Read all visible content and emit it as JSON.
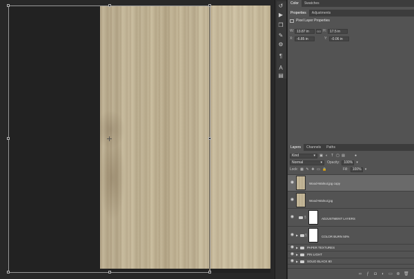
{
  "canvas": {
    "layer_top_name": "Wood-Walnut.jpg copy",
    "layer_name": "Wood-Walnut.jpg"
  },
  "toolbar": {
    "tools": [
      {
        "name": "history-icon",
        "glyph": "↺"
      },
      {
        "name": "play-icon",
        "glyph": "▶"
      },
      {
        "name": "clone-source-icon",
        "glyph": "❐"
      },
      {
        "name": "brush-settings-icon",
        "glyph": "✎"
      },
      {
        "name": "adjust-icon",
        "glyph": "⚙"
      },
      {
        "name": "paragraph-icon",
        "glyph": "¶"
      },
      {
        "name": "character-icon",
        "glyph": "A"
      },
      {
        "name": "notes-icon",
        "glyph": "▤"
      }
    ]
  },
  "top_panel": {
    "tabs": [
      "Color",
      "Swatches"
    ]
  },
  "properties_panel": {
    "tabs": [
      "Properties",
      "Adjustments"
    ],
    "section_title": "Pixel Layer Properties",
    "w_label": "W:",
    "w_value": "13.87 in",
    "h_label": "H:",
    "h_value": "17.5 in",
    "x_label": "X:",
    "x_value": "-6.85 in",
    "y_label": "Y:",
    "y_value": "-0.06 in",
    "link_label": "GO"
  },
  "layers_panel": {
    "tabs": [
      "Layers",
      "Channels",
      "Paths"
    ],
    "filter_label": "Kind",
    "blend_mode": "Normal",
    "opacity_label": "Opacity:",
    "opacity_value": "100%",
    "lock_label": "Lock:",
    "fill_label": "Fill:",
    "fill_value": "100%",
    "layers": [
      {
        "name": "Wood-Walnut.jpg copy",
        "type": "pixel",
        "selected": true
      },
      {
        "name": "Wood-Walnut.jpg",
        "type": "pixel",
        "selected": false
      },
      {
        "name": "ADJUSTMENT LAYERS",
        "type": "group-mask",
        "selected": false
      },
      {
        "name": "COLOR BURN 50%",
        "type": "group-mask",
        "selected": false
      },
      {
        "name": "PAPER TEXTURES",
        "type": "folder",
        "selected": false
      },
      {
        "name": "PIN LIGHT",
        "type": "folder",
        "selected": false
      },
      {
        "name": "SOLID BLACK 80",
        "type": "folder",
        "selected": false
      }
    ]
  }
}
